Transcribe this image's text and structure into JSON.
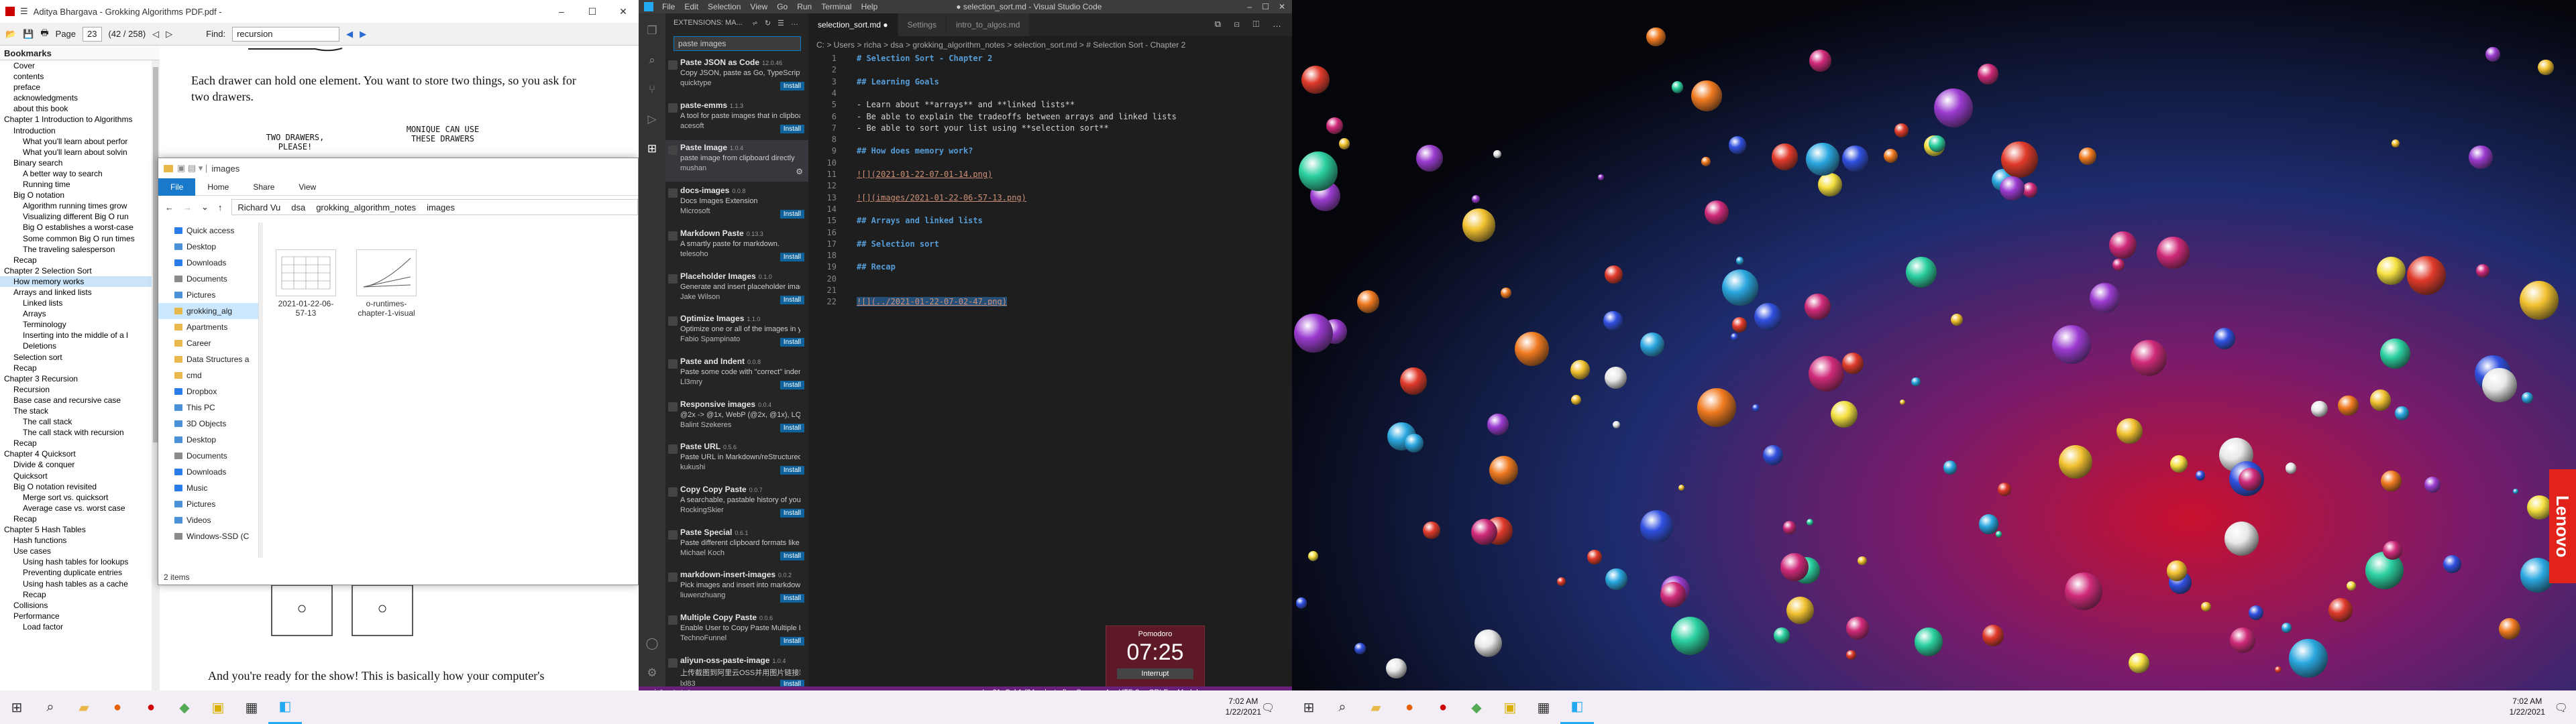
{
  "pdf": {
    "title": "Aditya Bhargava - Grokking Algorithms PDF.pdf -",
    "toolbar": {
      "page_label": "Page",
      "page_num": "23",
      "page_total": "(42 / 258)",
      "find_label": "Find:",
      "find_value": "recursion"
    },
    "bookmarks_header": "Bookmarks",
    "bookmarks": [
      {
        "label": "Cover",
        "indent": 1
      },
      {
        "label": "contents",
        "indent": 1
      },
      {
        "label": "preface",
        "indent": 1
      },
      {
        "label": "acknowledgments",
        "indent": 1
      },
      {
        "label": "about this book",
        "indent": 1
      },
      {
        "label": "Chapter 1 Introduction to Algorithms",
        "indent": 0
      },
      {
        "label": "Introduction",
        "indent": 1
      },
      {
        "label": "What you'll learn about perfor",
        "indent": 2
      },
      {
        "label": "What you'll learn about solvin",
        "indent": 2
      },
      {
        "label": "Binary search",
        "indent": 1
      },
      {
        "label": "A better way to search",
        "indent": 2
      },
      {
        "label": "Running time",
        "indent": 2
      },
      {
        "label": "Big O notation",
        "indent": 1
      },
      {
        "label": "Algorithm running times grow",
        "indent": 2
      },
      {
        "label": "Visualizing different Big O run",
        "indent": 2
      },
      {
        "label": "Big O establishes a worst-case",
        "indent": 2
      },
      {
        "label": "Some common Big O run times",
        "indent": 2
      },
      {
        "label": "The traveling salesperson",
        "indent": 2
      },
      {
        "label": "Recap",
        "indent": 1
      },
      {
        "label": "Chapter 2 Selection Sort",
        "indent": 0
      },
      {
        "label": "How memory works",
        "indent": 1,
        "selected": true
      },
      {
        "label": "Arrays and linked lists",
        "indent": 1
      },
      {
        "label": "Linked lists",
        "indent": 2
      },
      {
        "label": "Arrays",
        "indent": 2
      },
      {
        "label": "Terminology",
        "indent": 2
      },
      {
        "label": "Inserting into the middle of a l",
        "indent": 2
      },
      {
        "label": "Deletions",
        "indent": 2
      },
      {
        "label": "Selection sort",
        "indent": 1
      },
      {
        "label": "Recap",
        "indent": 1
      },
      {
        "label": "Chapter 3 Recursion",
        "indent": 0
      },
      {
        "label": "Recursion",
        "indent": 1
      },
      {
        "label": "Base case and recursive case",
        "indent": 1
      },
      {
        "label": "The stack",
        "indent": 1
      },
      {
        "label": "The call stack",
        "indent": 2
      },
      {
        "label": "The call stack with recursion",
        "indent": 2
      },
      {
        "label": "Recap",
        "indent": 1
      },
      {
        "label": "Chapter 4 Quicksort",
        "indent": 0
      },
      {
        "label": "Divide & conquer",
        "indent": 1
      },
      {
        "label": "Quicksort",
        "indent": 1
      },
      {
        "label": "Big O notation revisited",
        "indent": 1
      },
      {
        "label": "Merge sort vs. quicksort",
        "indent": 2
      },
      {
        "label": "Average case vs. worst case",
        "indent": 2
      },
      {
        "label": "Recap",
        "indent": 1
      },
      {
        "label": "Chapter 5 Hash Tables",
        "indent": 0
      },
      {
        "label": "Hash functions",
        "indent": 1
      },
      {
        "label": "Use cases",
        "indent": 1
      },
      {
        "label": "Using hash tables for lookups",
        "indent": 2
      },
      {
        "label": "Preventing duplicate entries",
        "indent": 2
      },
      {
        "label": "Using hash tables as a cache",
        "indent": 2
      },
      {
        "label": "Recap",
        "indent": 2
      },
      {
        "label": "Collisions",
        "indent": 1
      },
      {
        "label": "Performance",
        "indent": 1
      },
      {
        "label": "Load factor",
        "indent": 2
      }
    ],
    "page_text_top": "Each drawer can hold one element. You want to store two things, so you ask for two drawers.",
    "handwriting_left": "TWO DRAWERS, PLEASE!",
    "handwriting_right": "MONIQUE CAN USE THESE DRAWERS",
    "page_text_bottom": "And you're ready for the show! This is basically how your computer's"
  },
  "explorer": {
    "title": "images",
    "ribbon_tabs": [
      "File",
      "Home",
      "Share",
      "View"
    ],
    "path": [
      "Richard Vu",
      "dsa",
      "grokking_algorithm_notes",
      "images"
    ],
    "nav_items": [
      {
        "label": "Quick access",
        "color": "#2b7de9"
      },
      {
        "label": "Desktop",
        "color": "#4a90d9"
      },
      {
        "label": "Downloads",
        "color": "#2b7de9"
      },
      {
        "label": "Documents",
        "color": "#8a8a8a"
      },
      {
        "label": "Pictures",
        "color": "#4a90d9"
      },
      {
        "label": "grokking_alg",
        "color": "#e8b84a",
        "selected": true
      },
      {
        "label": "Apartments",
        "color": "#e8b84a"
      },
      {
        "label": "Career",
        "color": "#e8b84a"
      },
      {
        "label": "Data Structures a",
        "color": "#e8b84a"
      },
      {
        "label": "cmd",
        "color": "#e8b84a"
      },
      {
        "label": "Dropbox",
        "color": "#2b7de9"
      },
      {
        "label": "This PC",
        "color": "#4a90d9"
      },
      {
        "label": "3D Objects",
        "color": "#4a90d9"
      },
      {
        "label": "Desktop",
        "color": "#4a90d9"
      },
      {
        "label": "Documents",
        "color": "#8a8a8a"
      },
      {
        "label": "Downloads",
        "color": "#2b7de9"
      },
      {
        "label": "Music",
        "color": "#2b7de9"
      },
      {
        "label": "Pictures",
        "color": "#4a90d9"
      },
      {
        "label": "Videos",
        "color": "#4a90d9"
      },
      {
        "label": "Windows-SSD (C",
        "color": "#8a8a8a"
      }
    ],
    "files": [
      {
        "label": "2021-01-22-06-57-13"
      },
      {
        "label": "o-runtimes-chapter-1-visual"
      }
    ],
    "status": "2 items"
  },
  "vscode": {
    "menu": [
      "File",
      "Edit",
      "Selection",
      "View",
      "Go",
      "Run",
      "Terminal",
      "Help"
    ],
    "window_title": "● selection_sort.md - Visual Studio Code",
    "sidebar_title": "EXTENSIONS: MA...",
    "search_value": "paste images",
    "extensions": [
      {
        "name": "Paste JSON as Code",
        "version": "12.0.46",
        "desc": "Copy JSON, paste as Go, TypeScript, C...",
        "publisher": "quicktype",
        "button": "Install"
      },
      {
        "name": "paste-emms",
        "version": "1.1.3",
        "desc": "A tool for paste images that in clipboa...",
        "publisher": "acesoft",
        "button": "Install"
      },
      {
        "name": "Paste Image",
        "version": "1.0.4",
        "desc": "paste image from clipboard directly",
        "publisher": "mushan",
        "button": "",
        "selected": true
      },
      {
        "name": "docs-images",
        "version": "0.0.8",
        "desc": "Docs Images Extension",
        "publisher": "Microsoft",
        "button": "Install"
      },
      {
        "name": "Markdown Paste",
        "version": "0.13.3",
        "desc": "A smartly paste for markdown.",
        "publisher": "telesoho",
        "button": "Install"
      },
      {
        "name": "Placeholder Images",
        "version": "0.1.0",
        "desc": "Generate and insert placeholder imag...",
        "publisher": "Jake Wilson",
        "button": "Install"
      },
      {
        "name": "Optimize Images",
        "version": "1.1.0",
        "desc": "Optimize one or all of the images in you...",
        "publisher": "Fabio Spampinato",
        "button": "Install"
      },
      {
        "name": "Paste and Indent",
        "version": "0.0.8",
        "desc": "Paste some code with \"correct\" indent...",
        "publisher": "Ll3mry",
        "button": "Install"
      },
      {
        "name": "Responsive images",
        "version": "0.0.4",
        "desc": "@2x -> @1x, WebP (@2x, @1x), LQIP",
        "publisher": "Balint Szekeres",
        "button": "Install"
      },
      {
        "name": "Paste URL",
        "version": "0.5.6",
        "desc": "Paste URL in Markdown/reStructuredT...",
        "publisher": "kukushi",
        "button": "Install"
      },
      {
        "name": "Copy Copy Paste",
        "version": "0.0.7",
        "desc": "A searchable, pastable history of your ...",
        "publisher": "RockingSkier",
        "button": "Install"
      },
      {
        "name": "Paste Special",
        "version": "0.6.1",
        "desc": "Paste different clipboard formats like t...",
        "publisher": "Michael Koch",
        "button": "Install"
      },
      {
        "name": "markdown-insert-images",
        "version": "0.0.2",
        "desc": "Pick images and insert into markdown...",
        "publisher": "liuwenzhuang",
        "button": "Install"
      },
      {
        "name": "Multiple Copy Paste",
        "version": "0.0.6",
        "desc": "Enable User to Copy Paste Multiple Li...",
        "publisher": "TechnoFunnel",
        "button": "Install"
      },
      {
        "name": "aliyun-oss-paste-image",
        "version": "1.0.4",
        "desc": "上传截图到阿里云OSS并用图片链接粘贴",
        "publisher": "lxl83",
        "button": "Install"
      }
    ],
    "tabs": [
      {
        "label": "selection_sort.md ●",
        "active": true
      },
      {
        "label": "Settings",
        "active": false
      },
      {
        "label": "intro_to_algos.md",
        "active": false
      }
    ],
    "breadcrumb": "C: > Users > richa > dsa > grokking_algorithm_notes > selection_sort.md > # Selection Sort - Chapter 2",
    "lines": [
      {
        "n": "1",
        "text": "# Selection Sort - Chapter 2",
        "cls": "hd"
      },
      {
        "n": "2",
        "text": "",
        "cls": ""
      },
      {
        "n": "3",
        "text": "## Learning Goals",
        "cls": "hd"
      },
      {
        "n": "4",
        "text": "",
        "cls": ""
      },
      {
        "n": "5",
        "text": "- Learn about **arrays** and **linked lists**",
        "cls": ""
      },
      {
        "n": "6",
        "text": "- Be able to explain the tradeoffs between arrays and linked lists",
        "cls": ""
      },
      {
        "n": "7",
        "text": "- Be able to sort your list using **selection sort**",
        "cls": ""
      },
      {
        "n": "8",
        "text": "",
        "cls": ""
      },
      {
        "n": "9",
        "text": "## How does memory work?",
        "cls": "hd"
      },
      {
        "n": "10",
        "text": "",
        "cls": ""
      },
      {
        "n": "11",
        "text": "![](2021-01-22-07-01-14.png)",
        "cls": "lk"
      },
      {
        "n": "12",
        "text": "",
        "cls": ""
      },
      {
        "n": "13",
        "text": "![](images/2021-01-22-06-57-13.png)",
        "cls": "lk"
      },
      {
        "n": "14",
        "text": "",
        "cls": ""
      },
      {
        "n": "15",
        "text": "## Arrays and linked lists",
        "cls": "hd"
      },
      {
        "n": "16",
        "text": "",
        "cls": ""
      },
      {
        "n": "17",
        "text": "## Selection sort",
        "cls": "hd"
      },
      {
        "n": "18",
        "text": "",
        "cls": ""
      },
      {
        "n": "19",
        "text": "## Recap",
        "cls": "hd"
      },
      {
        "n": "20",
        "text": "",
        "cls": ""
      },
      {
        "n": "21",
        "text": "",
        "cls": ""
      },
      {
        "n": "22",
        "text": "![](../2021-01-22-07-02-47.png)",
        "cls": "lk sel-bg"
      }
    ],
    "status": {
      "branch": "main*",
      "errors": "0 ⚠ 0",
      "position": "Ln 21, Col 1 (34 selected)",
      "spaces": "Spaces: 4",
      "encoding": "UTF-8",
      "eol": "CRLF",
      "lang": "Markdown"
    },
    "pomodoro": {
      "label": "Pomodoro",
      "time": "07:25",
      "button": "Interrupt"
    }
  },
  "taskbar_left": {
    "time": "7:02 AM",
    "date": "1/22/2021"
  },
  "taskbar_right": {
    "time": "7:02 AM",
    "date": "1/22/2021"
  },
  "desktop": {
    "brand": "Lenovo"
  },
  "colors": {
    "vscode_status": "#68217a",
    "accent": "#007acc",
    "pomodoro": "#5d1a26"
  }
}
